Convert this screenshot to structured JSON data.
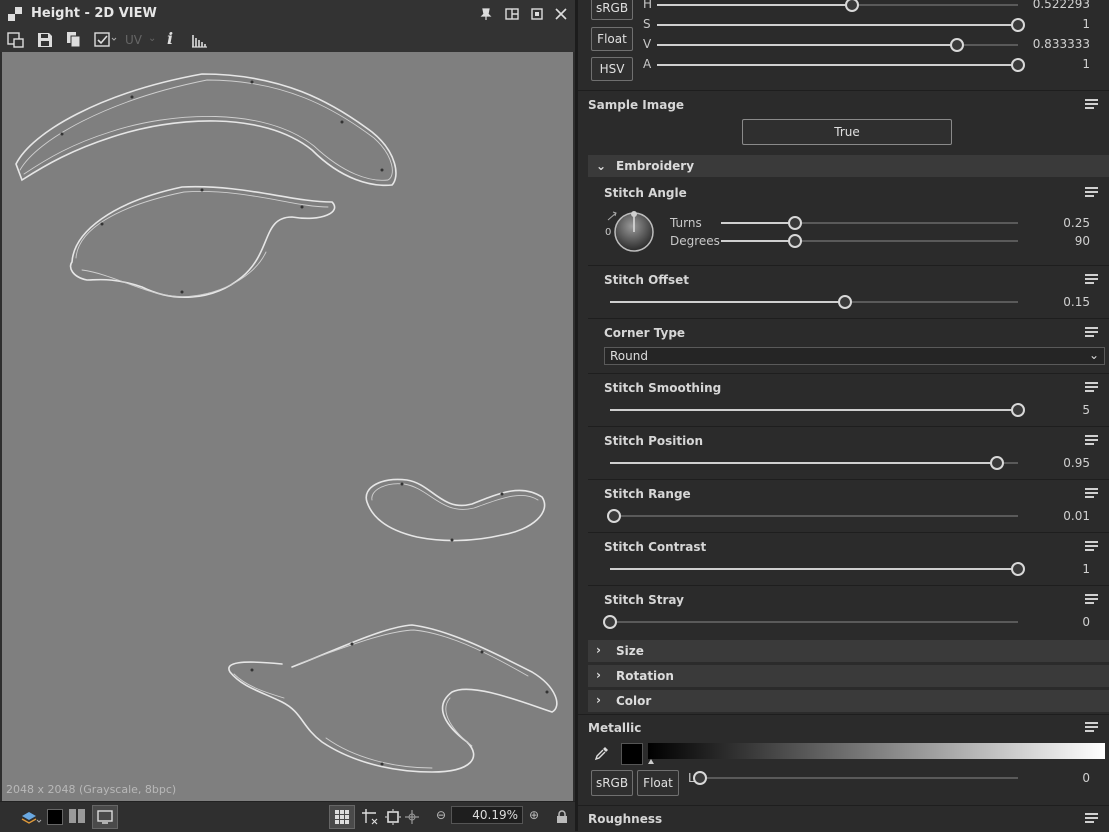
{
  "view": {
    "title": "Height - 2D VIEW",
    "uv_label": "UV",
    "info_icon": "i",
    "resolution": "2048 x 2048 (Grayscale, 8bpc)",
    "zoom": "40.19%"
  },
  "color_top": {
    "channels": [
      {
        "label": "H",
        "value": "0.522293",
        "level": 0.54
      },
      {
        "label": "S",
        "value": "1",
        "level": 1.0
      },
      {
        "label": "V",
        "value": "0.833333",
        "level": 0.83
      },
      {
        "label": "A",
        "value": "1",
        "level": 1.0
      }
    ],
    "btn_srgb": "sRGB",
    "btn_float": "Float",
    "btn_hsv": "HSV"
  },
  "sample_image": {
    "label": "Sample Image",
    "button": "True"
  },
  "embroidery": {
    "header": "Embroidery",
    "stitch_angle": {
      "label": "Stitch Angle",
      "zero": "0",
      "turns_label": "Turns",
      "turns_value": "0.25",
      "turns_level": 0.25,
      "degrees_label": "Degrees",
      "degrees_value": "90",
      "degrees_level": 0.25
    },
    "stitch_offset": {
      "label": "Stitch Offset",
      "value": "0.15",
      "level": 0.575
    },
    "corner_type": {
      "label": "Corner Type",
      "selected": "Round"
    },
    "stitch_smoothing": {
      "label": "Stitch Smoothing",
      "value": "5",
      "level": 1.0
    },
    "stitch_position": {
      "label": "Stitch Position",
      "value": "0.95",
      "level": 0.948
    },
    "stitch_range": {
      "label": "Stitch Range",
      "value": "0.01",
      "level": 0.01
    },
    "stitch_contrast": {
      "label": "Stitch Contrast",
      "value": "1",
      "level": 1.0
    },
    "stitch_stray": {
      "label": "Stitch Stray",
      "value": "0",
      "level": 0.0
    }
  },
  "collapsed": [
    {
      "label": "Size"
    },
    {
      "label": "Rotation"
    },
    {
      "label": "Color"
    }
  ],
  "metallic": {
    "label": "Metallic",
    "btn_srgb": "sRGB",
    "btn_float": "Float",
    "channel_label": "L",
    "value": "0",
    "level": 0.0
  },
  "roughness": {
    "label": "Roughness"
  },
  "colors": {
    "canvas": "#7f7f7f",
    "panel": "#2b2b2b",
    "section": "#3a3a3a"
  }
}
